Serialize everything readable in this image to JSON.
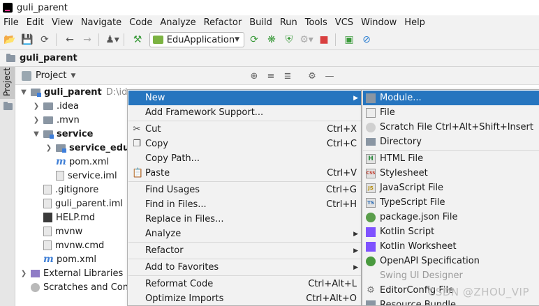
{
  "window": {
    "title": "guli_parent"
  },
  "menubar": {
    "items": [
      "File",
      "Edit",
      "View",
      "Navigate",
      "Code",
      "Analyze",
      "Refactor",
      "Build",
      "Run",
      "Tools",
      "VCS",
      "Window",
      "Help"
    ]
  },
  "toolbar": {
    "run_config": "EduApplication"
  },
  "navbar": {
    "crumb": "guli_parent"
  },
  "tool_window": {
    "side_tab": "Project",
    "title": "Project"
  },
  "tree": {
    "root": {
      "label": "guli_parent",
      "path": "D:\\idea"
    },
    "idea": ".idea",
    "mvn": ".mvn",
    "service": "service",
    "service_edu": "service_edu",
    "pom_service": "pom.xml",
    "service_iml": "service.iml",
    "gitignore": ".gitignore",
    "parent_iml": "guli_parent.iml",
    "help": "HELP.md",
    "mvnw": "mvnw",
    "mvnw_cmd": "mvnw.cmd",
    "pom_root": "pom.xml",
    "external": "External Libraries",
    "scratches": "Scratches and Consoles"
  },
  "context_menu": {
    "new": "New",
    "add_framework": "Add Framework Support...",
    "cut": {
      "label": "Cut",
      "shortcut": "Ctrl+X"
    },
    "copy": {
      "label": "Copy",
      "shortcut": "Ctrl+C"
    },
    "copy_path": "Copy Path...",
    "paste": {
      "label": "Paste",
      "shortcut": "Ctrl+V"
    },
    "find_usages": {
      "label": "Find Usages",
      "shortcut": "Ctrl+G"
    },
    "find_in_files": {
      "label": "Find in Files...",
      "shortcut": "Ctrl+H"
    },
    "replace_in_files": "Replace in Files...",
    "analyze": "Analyze",
    "refactor": "Refactor",
    "add_to_favorites": "Add to Favorites",
    "reformat": {
      "label": "Reformat Code",
      "shortcut": "Ctrl+Alt+L"
    },
    "optimize": {
      "label": "Optimize Imports",
      "shortcut": "Ctrl+Alt+O"
    }
  },
  "new_submenu": {
    "module": "Module...",
    "file": "File",
    "scratch": {
      "label": "Scratch File",
      "shortcut": "Ctrl+Alt+Shift+Insert"
    },
    "directory": "Directory",
    "html": "HTML File",
    "stylesheet": "Stylesheet",
    "javascript": "JavaScript File",
    "typescript": "TypeScript File",
    "package_json": "package.json File",
    "kotlin_script": "Kotlin Script",
    "kotlin_worksheet": "Kotlin Worksheet",
    "openapi": "OpenAPI Specification",
    "swing": "Swing UI Designer",
    "editorconfig": "EditorConfig File",
    "resource_bundle": "Resource Bundle"
  },
  "watermark": "CSDN @ZHOU_VIP",
  "colors": {
    "selection": "#2675bf",
    "menu_bg": "#f2f2f2"
  }
}
